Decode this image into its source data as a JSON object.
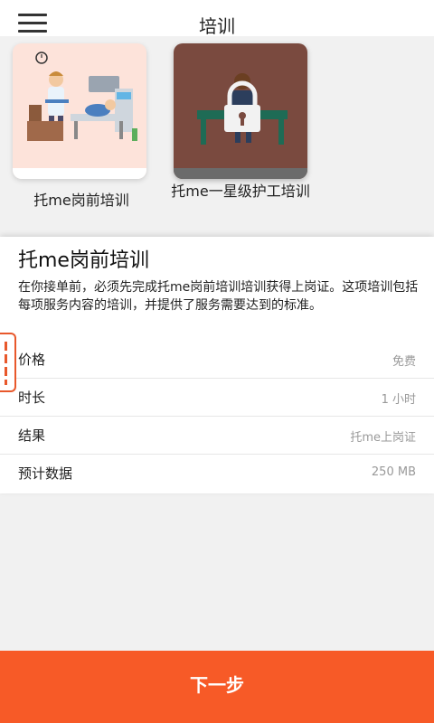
{
  "header": {
    "title": "培训"
  },
  "courses": [
    {
      "label": "托me岗前培训"
    },
    {
      "label": "托me一星级护工培训"
    }
  ],
  "detail": {
    "title": "托me岗前培训",
    "description": "在你接单前，必须先完成托me岗前培训培训获得上岗证。这项培训包括每项服务内容的培训，并提供了服务需要达到的标准。",
    "rows": [
      {
        "key": "价格",
        "value": "免费"
      },
      {
        "key": "时长",
        "value": "1 小时"
      },
      {
        "key": "结果",
        "value": "托me上岗证"
      },
      {
        "key": "预计数据",
        "value": "250 MB"
      }
    ]
  },
  "footer": {
    "next_label": "下一步"
  },
  "colors": {
    "accent": "#f75a27",
    "card1_bg": "#fde3da",
    "card2_bg": "#7a4a3f"
  }
}
